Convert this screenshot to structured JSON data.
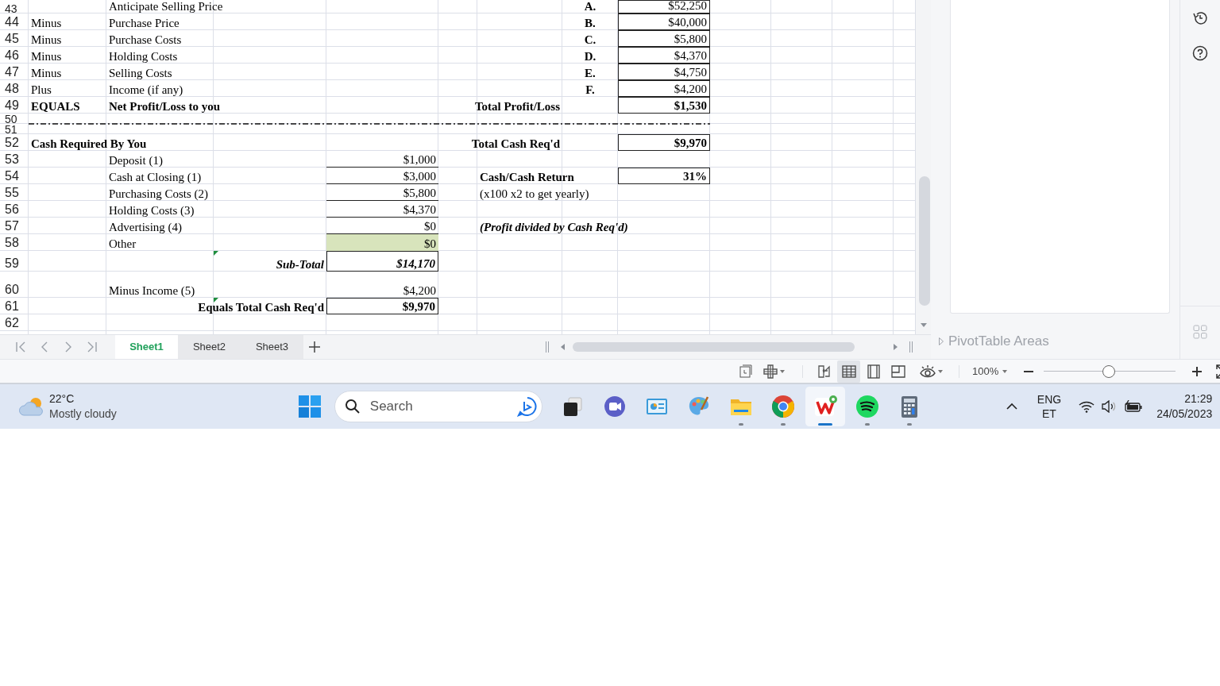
{
  "sheet": {
    "rows": [
      {
        "number": "43",
        "column_2": {
          "kind": "label",
          "text": "Anticipate Selling Price"
        },
        "column_7": {
          "kind": "letter",
          "text": "A."
        },
        "column_8": {
          "kind": "amount",
          "text": "$52,250",
          "boxed": true
        }
      },
      {
        "number": "44",
        "column_1": {
          "kind": "label",
          "text": "Minus"
        },
        "column_2": {
          "kind": "label",
          "text": "Purchase Price"
        },
        "column_7": {
          "kind": "letter",
          "text": "B."
        },
        "column_8": {
          "kind": "amount",
          "text": "$40,000",
          "boxed": true
        }
      },
      {
        "number": "45",
        "column_1": {
          "kind": "label",
          "text": "Minus"
        },
        "column_2": {
          "kind": "label",
          "text": "Purchase Costs"
        },
        "column_7": {
          "kind": "letter",
          "text": "C."
        },
        "column_8": {
          "kind": "amount",
          "text": "$5,800",
          "boxed": true
        }
      },
      {
        "number": "46",
        "column_1": {
          "kind": "label",
          "text": "Minus"
        },
        "column_2": {
          "kind": "label",
          "text": "Holding Costs"
        },
        "column_7": {
          "kind": "letter",
          "text": "D."
        },
        "column_8": {
          "kind": "amount",
          "text": "$4,370",
          "boxed": true
        }
      },
      {
        "number": "47",
        "column_1": {
          "kind": "label",
          "text": "Minus"
        },
        "column_2": {
          "kind": "label",
          "text": "Selling Costs"
        },
        "column_7": {
          "kind": "letter",
          "text": "E."
        },
        "column_8": {
          "kind": "amount",
          "text": "$4,750",
          "boxed": true
        }
      },
      {
        "number": "48",
        "column_1": {
          "kind": "label",
          "text": "Plus"
        },
        "column_2": {
          "kind": "label",
          "text": "Income (if any)"
        },
        "column_7": {
          "kind": "letter",
          "text": "F."
        },
        "column_8": {
          "kind": "amount",
          "text": "$4,200",
          "boxed": true
        }
      },
      {
        "number": "49",
        "column_1": {
          "kind": "heading",
          "text": "EQUALS"
        },
        "column_2": {
          "kind": "heading",
          "text": "Net Profit/Loss to you"
        },
        "column_6": {
          "kind": "heading-right",
          "text": "Total Profit/Loss"
        },
        "column_8": {
          "kind": "amount-bold",
          "text": "$1,530",
          "boxed": true
        }
      },
      {
        "number": "50"
      },
      {
        "number": "51",
        "dashed_border": true
      },
      {
        "number": "52",
        "column_1": {
          "kind": "heading",
          "text": "Cash Required By You"
        },
        "column_6": {
          "kind": "heading-right",
          "text": "Total Cash Req'd"
        },
        "column_8": {
          "kind": "amount-bold",
          "text": "$9,970",
          "boxed": true
        }
      },
      {
        "number": "53",
        "column_2": {
          "kind": "label",
          "text": "Deposit (1)"
        },
        "column_4": {
          "kind": "amount",
          "text": "$1,000",
          "ruled": true
        }
      },
      {
        "number": "54",
        "column_2": {
          "kind": "label",
          "text": "Cash at Closing (1)"
        },
        "column_4": {
          "kind": "amount",
          "text": "$3,000",
          "ruled": true
        },
        "column_6": {
          "kind": "heading",
          "text": "Cash/Cash Return"
        },
        "column_8": {
          "kind": "amount-bold",
          "text": "31%",
          "boxed": true
        }
      },
      {
        "number": "55",
        "column_2": {
          "kind": "label",
          "text": "Purchasing Costs (2)"
        },
        "column_4": {
          "kind": "amount",
          "text": "$5,800",
          "ruled": true
        },
        "column_6": {
          "kind": "label",
          "text": "(x100 x2 to get yearly)"
        }
      },
      {
        "number": "56",
        "column_2": {
          "kind": "label",
          "text": "Holding Costs (3)"
        },
        "column_4": {
          "kind": "amount",
          "text": "$4,370",
          "ruled": true
        }
      },
      {
        "number": "57",
        "column_2": {
          "kind": "label",
          "text": "Advertising (4)"
        },
        "column_4": {
          "kind": "amount",
          "text": "$0",
          "ruled": true
        },
        "column_6": {
          "kind": "note",
          "text": "(Profit divided by Cash Req'd)"
        }
      },
      {
        "number": "58",
        "column_2": {
          "kind": "label",
          "text": "Other"
        },
        "column_4": {
          "kind": "amount",
          "text": "$0",
          "highlighted": true
        }
      },
      {
        "number": "59",
        "column_3": {
          "kind": "note-right",
          "text": "Sub-Total",
          "flagged": true
        },
        "column_4": {
          "kind": "amount-italic",
          "text": "$14,170",
          "boxed": true
        }
      },
      {
        "number": "60",
        "column_2": {
          "kind": "label",
          "text": "Minus Income (5)"
        },
        "column_4": {
          "kind": "amount",
          "text": "$4,200"
        }
      },
      {
        "number": "61",
        "column_3": {
          "kind": "heading-right",
          "text": "Equals Total Cash Req'd",
          "flagged": true
        },
        "column_4": {
          "kind": "amount-bold",
          "text": "$9,970",
          "boxed": true
        }
      },
      {
        "number": "62"
      }
    ]
  },
  "sheet_tabs": [
    {
      "label": "Sheet1",
      "selected": true
    },
    {
      "label": "Sheet2",
      "selected": false
    },
    {
      "label": "Sheet3",
      "selected": false
    }
  ],
  "side_panel": {
    "section": "PivotTable Areas"
  },
  "status_bar": {
    "view_modes": [
      {
        "kind": "reading",
        "selected": false
      },
      {
        "kind": "normal",
        "selected": true
      },
      {
        "kind": "page-break",
        "selected": false
      },
      {
        "kind": "page-layout",
        "selected": false
      }
    ],
    "zoom": "100%",
    "zoom_slider": {
      "level": 0.49
    }
  },
  "taskbar": {
    "weather": {
      "temperature": "22°C",
      "condition": "Mostly cloudy"
    },
    "search": {
      "placeholder": "Search"
    },
    "apps": [
      {
        "kind": "task-view",
        "running": false,
        "active": false
      },
      {
        "kind": "chat",
        "running": false,
        "active": false
      },
      {
        "kind": "board",
        "running": false,
        "active": false
      },
      {
        "kind": "paint",
        "running": false,
        "active": false
      },
      {
        "kind": "folder",
        "running": true,
        "active": false
      },
      {
        "kind": "browser",
        "running": true,
        "active": false
      },
      {
        "kind": "office",
        "running": true,
        "active": true
      },
      {
        "kind": "music",
        "running": true,
        "active": false
      },
      {
        "kind": "calculator",
        "running": true,
        "active": false
      }
    ],
    "language": {
      "code": "ENG",
      "layout": "ET"
    },
    "clock": {
      "time": "21:29",
      "date": "24/05/2023"
    }
  }
}
